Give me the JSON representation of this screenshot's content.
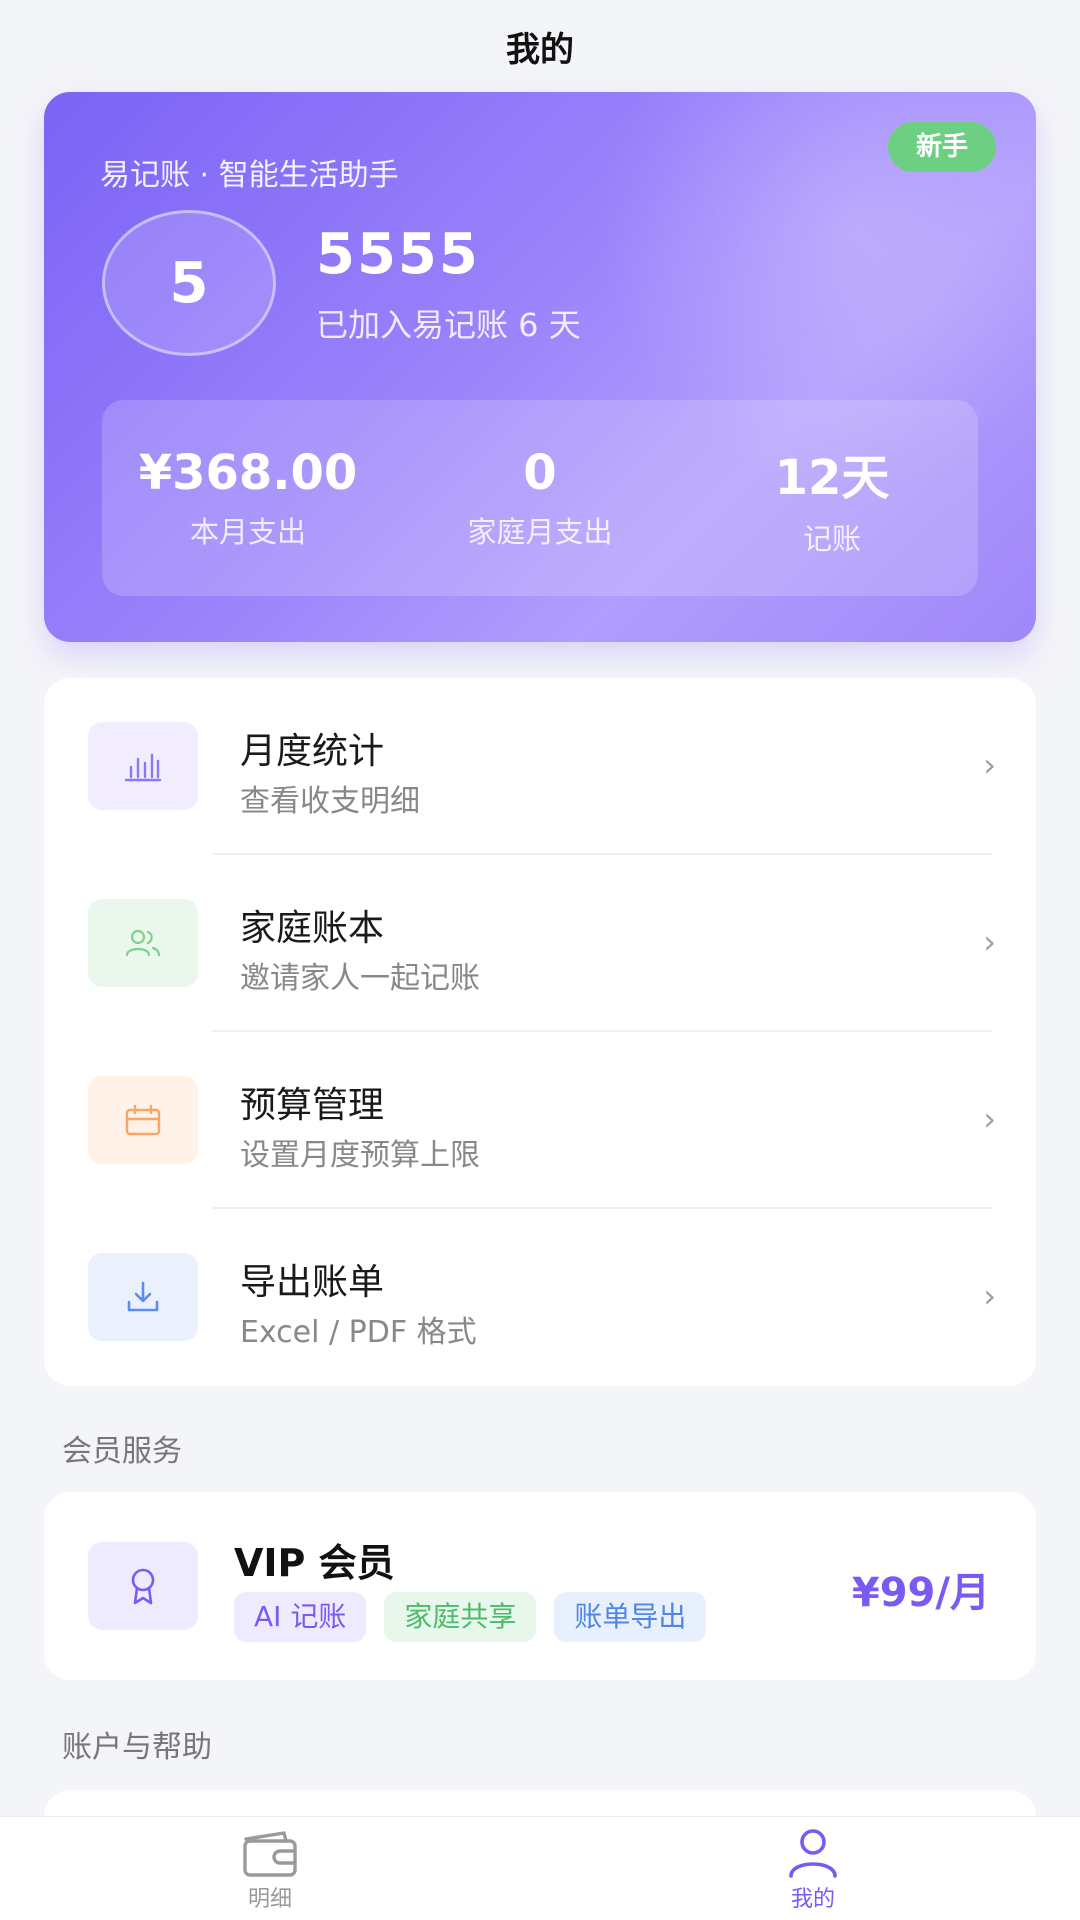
{
  "header": {
    "title": "我的"
  },
  "profile": {
    "app_slogan": "易记账 · 智能生活助手",
    "level_badge": "新手",
    "avatar_text": "5",
    "username": "5555",
    "joined_text": "已加入易记账 6 天",
    "stats": [
      {
        "value": "¥368.00",
        "label": "本月支出"
      },
      {
        "value": "0",
        "label": "家庭月支出"
      },
      {
        "value": "12天",
        "label": "记账"
      }
    ]
  },
  "menu": {
    "items": [
      {
        "title": "月度统计",
        "subtitle": "查看收支明细",
        "icon": "bar-chart-icon",
        "icon_bg": "#f1edfe",
        "icon_color": "#8d78f4"
      },
      {
        "title": "家庭账本",
        "subtitle": "邀请家人一起记账",
        "icon": "users-icon",
        "icon_bg": "#e9f7ec",
        "icon_color": "#7fd08f"
      },
      {
        "title": "预算管理",
        "subtitle": "设置月度预算上限",
        "icon": "calendar-icon",
        "icon_bg": "#fff2e8",
        "icon_color": "#f7a66a"
      },
      {
        "title": "导出账单",
        "subtitle": "Excel / PDF 格式",
        "icon": "download-icon",
        "icon_bg": "#eaf1fd",
        "icon_color": "#5b8ded"
      }
    ],
    "arrow": "›"
  },
  "member_section": {
    "title": "会员服务",
    "vip": {
      "title": "VIP 会员",
      "tags": [
        {
          "label": "AI 记账",
          "bg": "#efebfe",
          "color": "#7a5af2"
        },
        {
          "label": "家庭共享",
          "bg": "#e8f7ec",
          "color": "#4cbb6a"
        },
        {
          "label": "账单导出",
          "bg": "#e8f0fd",
          "color": "#4f86e6"
        }
      ],
      "price": "¥99/月"
    }
  },
  "account_section": {
    "title": "账户与帮助"
  },
  "tabbar": {
    "tabs": [
      {
        "label": "明细",
        "icon": "wallet-icon",
        "active": false
      },
      {
        "label": "我的",
        "icon": "user-icon",
        "active": true
      }
    ],
    "active_color": "#7a5af2",
    "inactive_color": "#999999"
  }
}
